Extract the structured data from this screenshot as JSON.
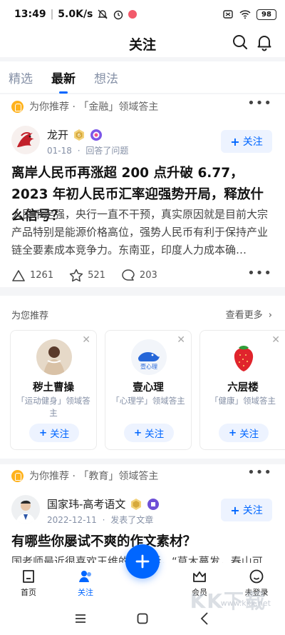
{
  "status_bar": {
    "time": "13:49",
    "speed": "5.0K/s",
    "battery": "98"
  },
  "header": {
    "title": "关注"
  },
  "tabs": [
    {
      "label": "精选"
    },
    {
      "label": "最新"
    },
    {
      "label": "想法"
    }
  ],
  "feed": [
    {
      "recommend_reason": "为你推荐 · 「金融」领域答主",
      "author": "龙开",
      "date": "01-18",
      "action": "回答了问题",
      "follow_label": "关注",
      "title": "离岸人民币再涨超 200 点升破 6.77，2023 年初人民币汇率迎强势开局，释放什么信号？",
      "excerpt": "人民币走强，央行一直不干预，真实原因就是目前大宗产品特别是能源价格高位，强势人民币有利于保持产业链全要素成本竞争力。东南亚，印度人力成本确…",
      "likes": "1261",
      "favorites": "521",
      "comments": "203"
    },
    {
      "recommend_reason": "为你推荐 · 「教育」领域答主",
      "author": "国家玮-高考语文",
      "date": "2022-12-11",
      "action": "发表了文章",
      "follow_label": "关注",
      "title": "有哪些你屡试不爽的作文素材？",
      "excerpt": "国老师最近很喜欢王维的一一话，“草木蔓发，春山可"
    }
  ],
  "recommend": {
    "title": "为您推荐",
    "see_more": "查看更多",
    "items": [
      {
        "name": "秽土曹操",
        "desc": "「运动健身」领域答主",
        "follow_label": "关注"
      },
      {
        "name": "壹心理",
        "desc": "「心理学」领域答主",
        "follow_label": "关注"
      },
      {
        "name": "六层楼",
        "desc": "「健康」领域答主",
        "follow_label": "关注"
      }
    ]
  },
  "bottom_nav": [
    {
      "label": "首页"
    },
    {
      "label": "关注"
    },
    {
      "label": "会员"
    },
    {
      "label": "未登录"
    }
  ],
  "watermark": {
    "text": "KK下载",
    "url": "www.kkx.net"
  },
  "colors": {
    "accent": "#0066ff",
    "follow_bg": "#edf3ff",
    "muted": "#8590a6"
  }
}
